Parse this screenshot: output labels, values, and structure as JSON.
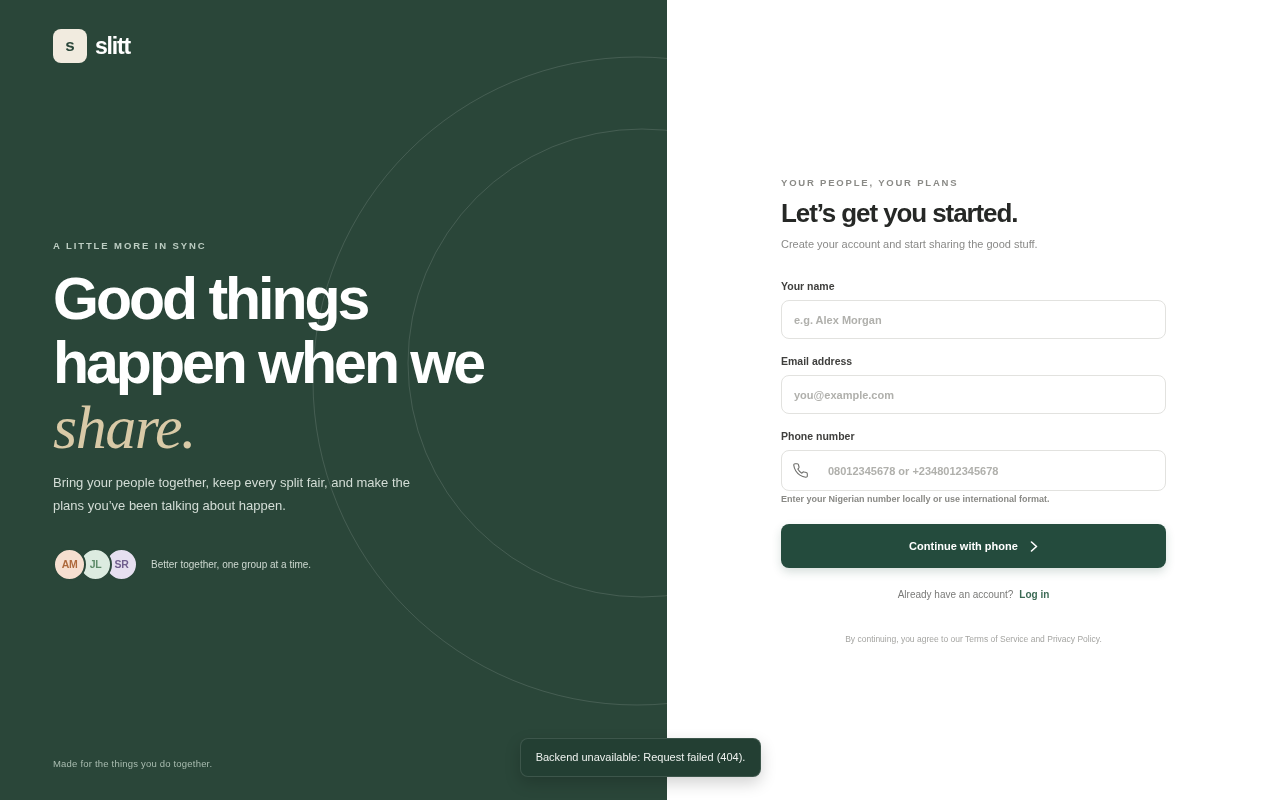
{
  "brand": {
    "mark": "s",
    "name": "slitt"
  },
  "hero": {
    "eyebrow": "A LITTLE MORE IN SYNC",
    "headline": "Good things happen when we *share.*",
    "body": "Bring your people together, keep every split fair, and make the plans you’ve been talking about happen.",
    "avatars": [
      {
        "initials": "AM",
        "color": "#f6dfd0"
      },
      {
        "initials": "JL",
        "color": "#dcebe0"
      },
      {
        "initials": "SR",
        "color": "#e6e0f0"
      }
    ],
    "avatars_caption": "Better together, one group at a time."
  },
  "footer_note": "Made for the things you do together.",
  "signup": {
    "eyebrow": "YOUR PEOPLE, YOUR PLANS",
    "title": "Let’s get you started.",
    "subtitle": "Create your account and start sharing the good stuff.",
    "fields": [
      {
        "kind": "text",
        "label": "Your name",
        "placeholder": "e.g. Alex Morgan"
      },
      {
        "kind": "email",
        "label": "Email address",
        "placeholder": "you@example.com"
      },
      {
        "kind": "phone",
        "label": "Phone number",
        "placeholder": "08012345678 or +2348012345678",
        "hint": "Enter your Nigerian number locally or use international format."
      }
    ],
    "submit": "Continue with phone",
    "login_prompt": "Already have an account?",
    "login_link": "Log in",
    "legal": "By continuing, you agree to our Terms of Service and Privacy Policy."
  },
  "toast": {
    "message": "Backend unavailable: Request failed (404)."
  }
}
